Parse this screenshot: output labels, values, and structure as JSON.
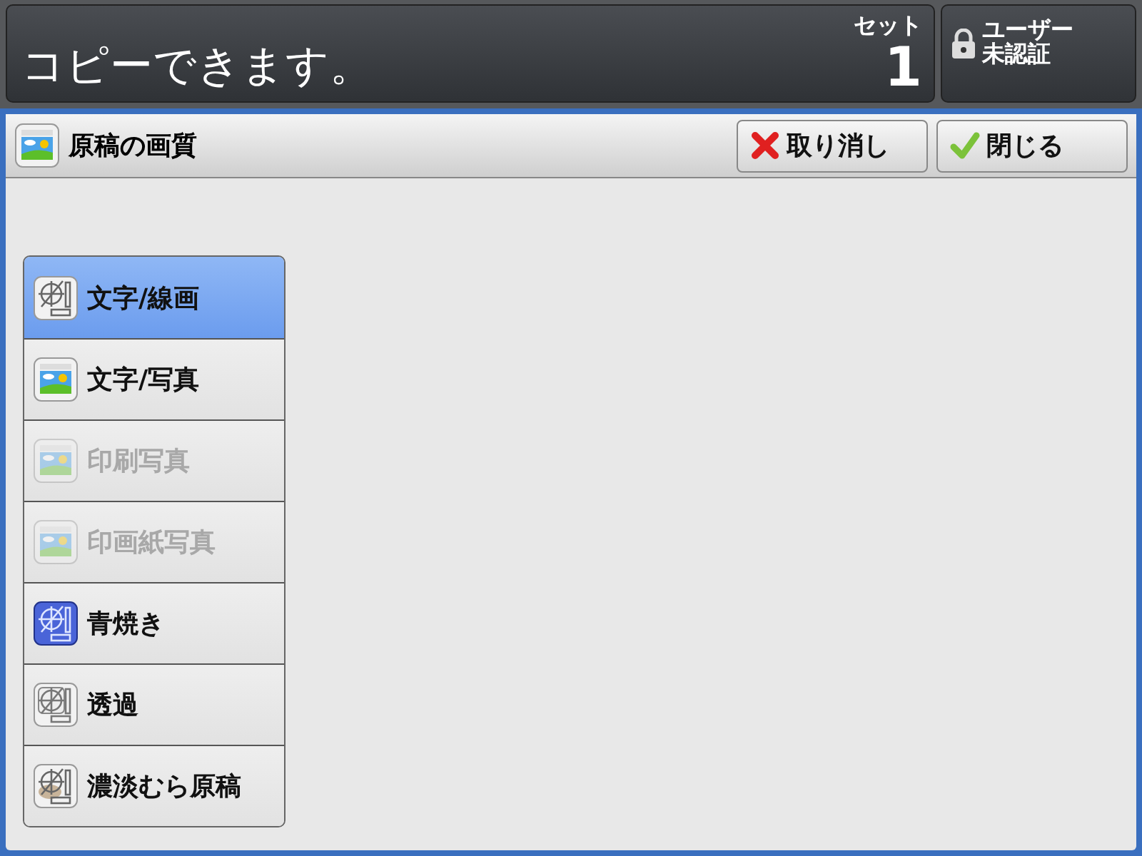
{
  "status": {
    "message": "コピーできます。",
    "set_label": "セット",
    "set_count": "1"
  },
  "user_button": {
    "label_line1": "ユーザー",
    "label_line2": "未認証"
  },
  "panel": {
    "title": "原稿の画質",
    "cancel_button": "取り消し",
    "close_button": "閉じる"
  },
  "options": [
    {
      "label": "文字/線画",
      "kind": "target",
      "selected": true,
      "disabled": false
    },
    {
      "label": "文字/写真",
      "kind": "photo",
      "selected": false,
      "disabled": false
    },
    {
      "label": "印刷写真",
      "kind": "photo",
      "selected": false,
      "disabled": true
    },
    {
      "label": "印画紙写真",
      "kind": "photo",
      "selected": false,
      "disabled": true
    },
    {
      "label": "青焼き",
      "kind": "blueprint",
      "selected": false,
      "disabled": false
    },
    {
      "label": "透過",
      "kind": "layers",
      "selected": false,
      "disabled": false
    },
    {
      "label": "濃淡むら原稿",
      "kind": "smudge",
      "selected": false,
      "disabled": false
    }
  ]
}
